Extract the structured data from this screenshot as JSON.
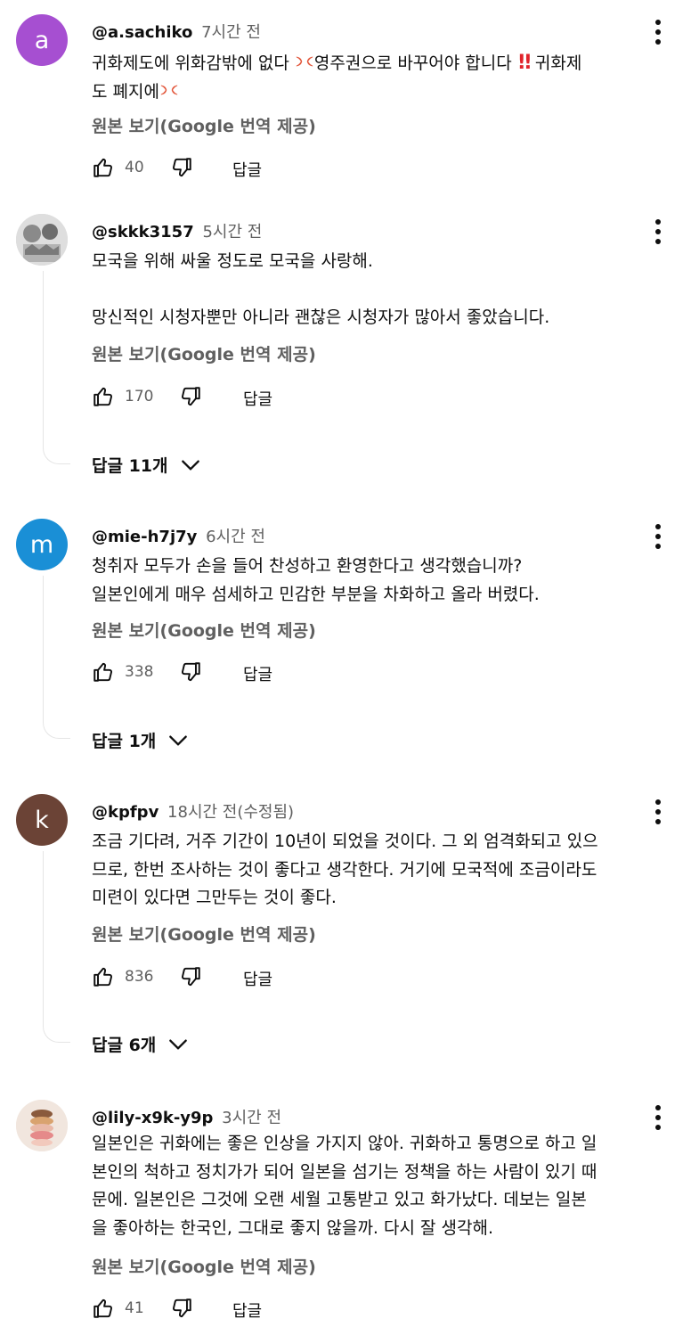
{
  "ui": {
    "translation_label": "원본 보기(Google 번역 제공)",
    "reply_label": "답글",
    "icons": {
      "like": "thumb-up-icon",
      "dislike": "thumb-down-icon",
      "more": "more-vert-icon",
      "expand": "chevron-down-icon",
      "anger": "anger-emoji",
      "bang": "double-exclamation-emoji"
    }
  },
  "comments": [
    {
      "avatar_letter": "a",
      "avatar_color": "#a64fd1",
      "handle": "@a.sachiko",
      "time": "7시간 전",
      "text_1": "귀화제도에 위화감밖에 없다 ",
      "text_2": "영주권으로 바꾸어야 합니다 ",
      "text_3": " 귀화제\n도 폐지에",
      "likes": "40",
      "replies": ""
    },
    {
      "avatar_letter": "",
      "avatar_color": "#cfcfcf",
      "handle": "@skkk3157",
      "time": "5시간 전",
      "text": "모국을 위해 싸울 정도로 모국을 사랑해.\n\n망신적인 시청자뿐만 아니라 괜찮은 시청자가 많아서 좋았습니다.",
      "likes": "170",
      "replies": "답글 11개"
    },
    {
      "avatar_letter": "m",
      "avatar_color": "#1a8fd6",
      "handle": "@mie-h7j7y",
      "time": "6시간 전",
      "text": "청취자 모두가 손을 들어 찬성하고 환영한다고 생각했습니까?\n일본인에게 매우 섬세하고 민감한 부분을 차화하고 올라 버렸다.",
      "likes": "338",
      "replies": "답글 1개"
    },
    {
      "avatar_letter": "k",
      "avatar_color": "#6b4336",
      "handle": "@kpfpv",
      "time": "18시간 전(수정됨)",
      "text": "조금 기다려, 거주 기간이 10년이 되었을 것이다. 그 외 엄격화되고 있으\n므로, 한번 조사하는 것이 좋다고 생각한다. 거기에 모국적에 조금이라도\n미련이 있다면 그만두는 것이 좋다.",
      "likes": "836",
      "replies": "답글 6개"
    },
    {
      "avatar_letter": "",
      "avatar_color": "#e9d9cf",
      "handle": "@lily-x9k-y9p",
      "time": "3시간 전",
      "text": "일본인은 귀화에는 좋은 인상을 가지지 않아. 귀화하고 통명으로 하고 일\n본인의 척하고 정치가가 되어 일본을 섬기는 정책을 하는 사람이 있기 때\n문에. 일본인은 그것에 오랜 세월 고통받고 있고 화가났다. 데보는 일본\n을 좋아하는 한국인, 그대로 좋지 않을까. 다시 잘 생각해.",
      "likes": "41",
      "replies": ""
    }
  ]
}
